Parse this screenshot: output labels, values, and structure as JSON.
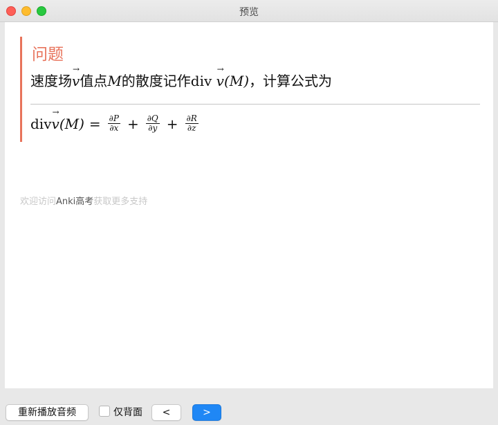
{
  "window": {
    "title": "预览"
  },
  "card": {
    "heading": "问题",
    "question": {
      "prefix": "速度场",
      "vec": "v",
      "mid": "值点",
      "point": "M",
      "after_point": "的散度记作div ",
      "vec2": "v",
      "paren": "(M)",
      "suffix": "，计算公式为"
    },
    "formula": {
      "lhs_div": "div ",
      "lhs_vec": "v",
      "lhs_paren": "(M)",
      "eq": "=",
      "plus": "+",
      "fractions": [
        {
          "num": "∂P",
          "den": "∂x"
        },
        {
          "num": "∂Q",
          "den": "∂y"
        },
        {
          "num": "∂R",
          "den": "∂z"
        }
      ]
    }
  },
  "footer": {
    "pre": "欢迎访问",
    "link": "Anki高考",
    "post": "获取更多支持"
  },
  "toolbar": {
    "replay_label": "重新播放音频",
    "back_only_label": "仅背面",
    "prev_label": "<",
    "next_label": ">"
  },
  "colors": {
    "accent": "#e8735b",
    "primary_button": "#1f87f5"
  }
}
